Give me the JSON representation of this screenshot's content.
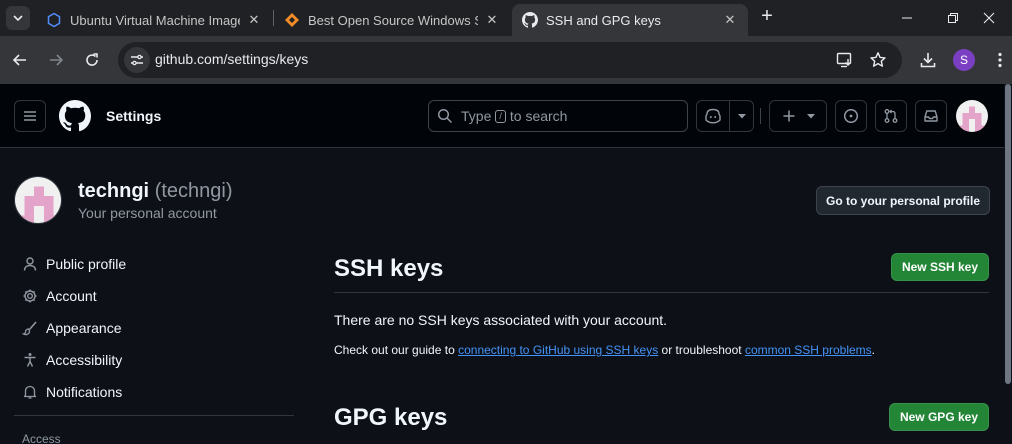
{
  "browser": {
    "tabs": [
      {
        "title": "Ubuntu Virtual Machine Images",
        "favicon": "hexagon-icon",
        "active": false
      },
      {
        "title": "Best Open Source Windows Software",
        "favicon": "diamond-icon",
        "active": false
      },
      {
        "title": "SSH and GPG keys",
        "favicon": "github-icon",
        "active": true
      }
    ],
    "address": "github.com/settings/keys",
    "profile_initial": "S"
  },
  "header": {
    "context_label": "Settings",
    "search": {
      "prefix": "Type",
      "key": "/",
      "suffix": "to search"
    }
  },
  "account": {
    "name": "techngi",
    "handle": "(techngi)",
    "subtitle": "Your personal account",
    "profile_button": "Go to your personal profile"
  },
  "sidebar": {
    "items": [
      {
        "label": "Public profile",
        "icon": "person-icon"
      },
      {
        "label": "Account",
        "icon": "gear-icon"
      },
      {
        "label": "Appearance",
        "icon": "paintbrush-icon"
      },
      {
        "label": "Accessibility",
        "icon": "accessibility-icon"
      },
      {
        "label": "Notifications",
        "icon": "bell-icon"
      }
    ],
    "group_heading": "Access"
  },
  "ssh": {
    "title": "SSH keys",
    "new_button": "New SSH key",
    "empty_message": "There are no SSH keys associated with your account.",
    "guide_prefix": "Check out our guide to",
    "guide_link": "connecting to GitHub using SSH keys",
    "guide_middle": "or troubleshoot",
    "guide_link2": "common SSH problems",
    "guide_suffix": "."
  },
  "gpg": {
    "title": "GPG keys",
    "new_button": "New GPG key"
  },
  "colors": {
    "page_bg": "#0d1117",
    "header_bg": "#010409",
    "primary_button": "#238636",
    "link": "#4493f8",
    "avatar_pink": "#e4a3c9"
  }
}
